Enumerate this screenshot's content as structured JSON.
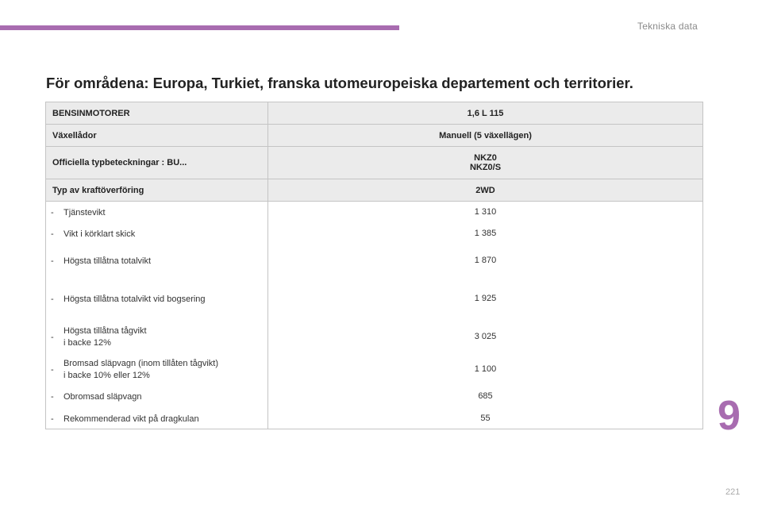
{
  "header": {
    "section_label": "Tekniska data",
    "accent_color": "#a86cb0"
  },
  "title": "För områdena: Europa, Turkiet, franska utomeuropeiska departement och territorier.",
  "table": {
    "engine_label": "BENSINMOTORER",
    "engine_value": "1,6 L 115",
    "gearbox_label": "Växellådor",
    "gearbox_value": "Manuell (5 växellägen)",
    "type_label": "Officiella typbeteckningar : BU...",
    "type_values": [
      "NKZ0",
      "NKZ0/S"
    ],
    "drive_label": "Typ av kraftöverföring",
    "drive_value": "2WD",
    "rows": [
      {
        "dash": "-",
        "label_lines": [
          "Tjänstevikt"
        ],
        "value": "1 310"
      },
      {
        "dash": "-",
        "label_lines": [
          "Vikt i körklart skick"
        ],
        "value": "1 385"
      },
      {
        "dash": "-",
        "label_lines": [
          "Högsta tillåtna totalvikt"
        ],
        "value": "1 870"
      },
      {
        "dash": "-",
        "label_lines": [
          "Högsta tillåtna totalvikt vid bogsering"
        ],
        "value": "1 925"
      },
      {
        "dash": "-",
        "label_lines": [
          "Högsta tillåtna tågvikt",
          "i backe 12%"
        ],
        "value": "3 025"
      },
      {
        "dash": "-",
        "label_lines": [
          "Bromsad släpvagn (inom tillåten tågvikt)",
          "i backe 10% eller 12%"
        ],
        "value": "1 100"
      },
      {
        "dash": "-",
        "label_lines": [
          "Obromsad släpvagn"
        ],
        "value": "685"
      },
      {
        "dash": "-",
        "label_lines": [
          "Rekommenderad vikt på dragkulan"
        ],
        "value": "55"
      }
    ]
  },
  "chapter_number": "9",
  "page_number": "221"
}
